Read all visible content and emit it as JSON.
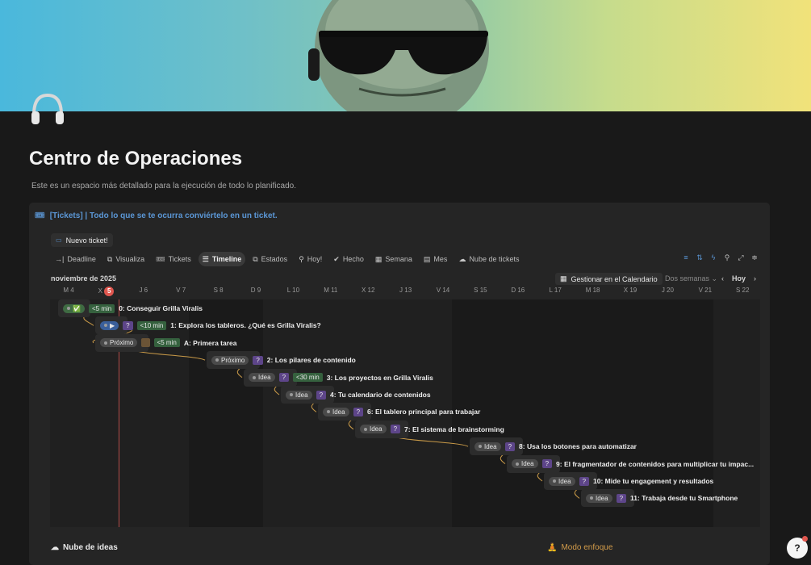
{
  "page": {
    "title": "Centro de Operaciones",
    "description": "Este es un espacio más detallado para la ejecución de todo lo planificado."
  },
  "database": {
    "title": "[Tickets] | Todo lo que se te ocurra conviértelo en un ticket.",
    "new_button": "Nuevo ticket!",
    "tabs": [
      {
        "label": "Deadline",
        "icon": "→|"
      },
      {
        "label": "Visualiza",
        "icon": "⧉"
      },
      {
        "label": "Tickets",
        "icon": "🎟"
      },
      {
        "label": "Timeline",
        "icon": "☰",
        "active": true
      },
      {
        "label": "Estados",
        "icon": "⧉"
      },
      {
        "label": "Hoy!",
        "icon": "⚲"
      },
      {
        "label": "Hecho",
        "icon": "✔"
      },
      {
        "label": "Semana",
        "icon": "▦"
      },
      {
        "label": "Mes",
        "icon": "▤"
      },
      {
        "label": "Nube de tickets",
        "icon": "☁"
      }
    ],
    "tools": [
      "filter-icon",
      "sort-icon",
      "lightning-icon",
      "search-icon",
      "expand-icon",
      "settings-icon"
    ]
  },
  "timeline": {
    "month": "noviembre de 2025",
    "calendar_button": "Gestionar en el Calendario",
    "range": "Dos semanas",
    "today_label": "Hoy",
    "days": [
      {
        "w": "M",
        "d": "4"
      },
      {
        "w": "X",
        "d": "5",
        "today": true
      },
      {
        "w": "J",
        "d": "6"
      },
      {
        "w": "V",
        "d": "7"
      },
      {
        "w": "S",
        "d": "8"
      },
      {
        "w": "D",
        "d": "9"
      },
      {
        "w": "L",
        "d": "10"
      },
      {
        "w": "M",
        "d": "11"
      },
      {
        "w": "X",
        "d": "12"
      },
      {
        "w": "J",
        "d": "13"
      },
      {
        "w": "V",
        "d": "14"
      },
      {
        "w": "S",
        "d": "15"
      },
      {
        "w": "D",
        "d": "16"
      },
      {
        "w": "L",
        "d": "17"
      },
      {
        "w": "M",
        "d": "18"
      },
      {
        "w": "X",
        "d": "19"
      },
      {
        "w": "J",
        "d": "20"
      },
      {
        "w": "V",
        "d": "21"
      },
      {
        "w": "S",
        "d": "22"
      }
    ],
    "items": [
      {
        "status": "✅",
        "status_color": "green",
        "time": "<5 min",
        "title": "0: Conseguir Grilla Viralis"
      },
      {
        "status": "▶",
        "status_color": "blue",
        "tag": "?",
        "time": "<10 min",
        "title": "1: Explora los tableros. ¿Qué es Grilla Viralis?"
      },
      {
        "status": "Próximo",
        "status_color": "grey",
        "tag": "",
        "time": "<5 min",
        "title": "A: Primera tarea"
      },
      {
        "status": "Próximo",
        "status_color": "grey",
        "tag": "?",
        "title": "2: Los pilares de contenido"
      },
      {
        "status": "Idea",
        "status_color": "grey",
        "tag": "?",
        "time": "<30 min",
        "title": "3: Los proyectos en Grilla Viralis"
      },
      {
        "status": "Idea",
        "status_color": "grey",
        "tag": "?",
        "title": "4: Tu calendario de contenidos"
      },
      {
        "status": "Idea",
        "status_color": "grey",
        "tag": "?",
        "title": "6: El tablero principal para trabajar"
      },
      {
        "status": "Idea",
        "status_color": "grey",
        "tag": "?",
        "title": "7: El sistema de brainstorming"
      },
      {
        "status": "Idea",
        "status_color": "grey",
        "tag": "?",
        "title": "8: Usa los botones para automatizar"
      },
      {
        "status": "Idea",
        "status_color": "grey",
        "tag": "?",
        "title": "9: El fragmentador de contenidos para multiplicar tu impac..."
      },
      {
        "status": "Idea",
        "status_color": "grey",
        "tag": "?",
        "title": "10: Mide tu engagement y resultados"
      },
      {
        "status": "Idea",
        "status_color": "grey",
        "tag": "?",
        "title": "11: Trabaja desde tu Smartphone"
      }
    ]
  },
  "footer": {
    "left": "Nube de ideas",
    "right": "Modo enfoque"
  }
}
